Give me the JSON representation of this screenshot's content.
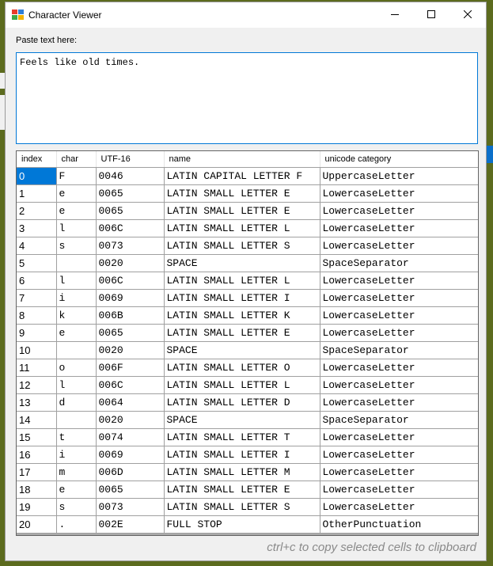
{
  "window": {
    "title": "Character Viewer"
  },
  "paste": {
    "label": "Paste text here:",
    "value": "Feels like old times."
  },
  "table": {
    "headers": [
      "index",
      "char",
      "UTF-16",
      "name",
      "unicode category"
    ],
    "rows": [
      [
        "0",
        "F",
        "0046",
        "LATIN CAPITAL LETTER F",
        "UppercaseLetter"
      ],
      [
        "1",
        "e",
        "0065",
        "LATIN SMALL LETTER E",
        "LowercaseLetter"
      ],
      [
        "2",
        "e",
        "0065",
        "LATIN SMALL LETTER E",
        "LowercaseLetter"
      ],
      [
        "3",
        "l",
        "006C",
        "LATIN SMALL LETTER L",
        "LowercaseLetter"
      ],
      [
        "4",
        "s",
        "0073",
        "LATIN SMALL LETTER S",
        "LowercaseLetter"
      ],
      [
        "5",
        "",
        "0020",
        "SPACE",
        "SpaceSeparator"
      ],
      [
        "6",
        "l",
        "006C",
        "LATIN SMALL LETTER L",
        "LowercaseLetter"
      ],
      [
        "7",
        "i",
        "0069",
        "LATIN SMALL LETTER I",
        "LowercaseLetter"
      ],
      [
        "8",
        "k",
        "006B",
        "LATIN SMALL LETTER K",
        "LowercaseLetter"
      ],
      [
        "9",
        "e",
        "0065",
        "LATIN SMALL LETTER E",
        "LowercaseLetter"
      ],
      [
        "10",
        "",
        "0020",
        "SPACE",
        "SpaceSeparator"
      ],
      [
        "11",
        "o",
        "006F",
        "LATIN SMALL LETTER O",
        "LowercaseLetter"
      ],
      [
        "12",
        "l",
        "006C",
        "LATIN SMALL LETTER L",
        "LowercaseLetter"
      ],
      [
        "13",
        "d",
        "0064",
        "LATIN SMALL LETTER D",
        "LowercaseLetter"
      ],
      [
        "14",
        "",
        "0020",
        "SPACE",
        "SpaceSeparator"
      ],
      [
        "15",
        "t",
        "0074",
        "LATIN SMALL LETTER T",
        "LowercaseLetter"
      ],
      [
        "16",
        "i",
        "0069",
        "LATIN SMALL LETTER I",
        "LowercaseLetter"
      ],
      [
        "17",
        "m",
        "006D",
        "LATIN SMALL LETTER M",
        "LowercaseLetter"
      ],
      [
        "18",
        "e",
        "0065",
        "LATIN SMALL LETTER E",
        "LowercaseLetter"
      ],
      [
        "19",
        "s",
        "0073",
        "LATIN SMALL LETTER S",
        "LowercaseLetter"
      ],
      [
        "20",
        ".",
        "002E",
        "FULL STOP",
        "OtherPunctuation"
      ]
    ],
    "selected_cell": "0"
  },
  "footer": {
    "hint": "ctrl+c to copy selected cells to clipboard"
  },
  "colors": {
    "accent": "#0078d7",
    "desktop": "#5c6b1e"
  },
  "icons": [
    "app-icon",
    "minimize-icon",
    "maximize-icon",
    "close-icon"
  ]
}
